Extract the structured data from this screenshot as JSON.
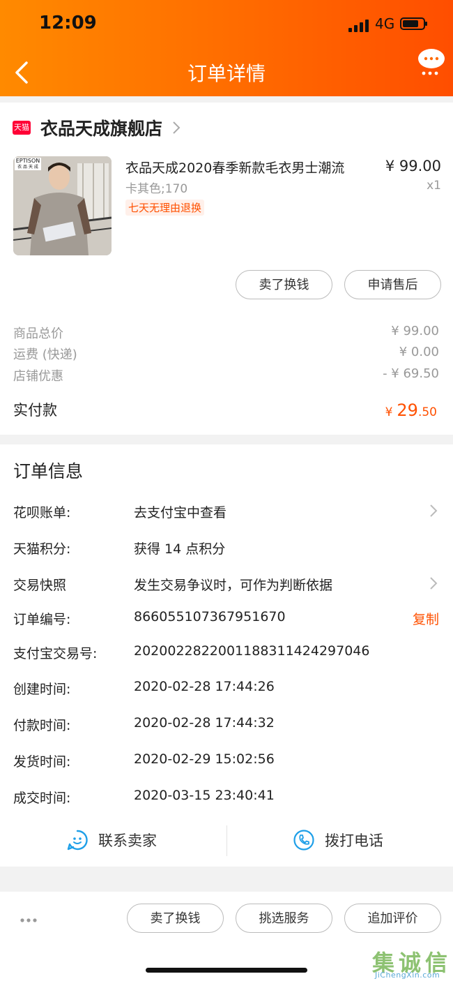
{
  "status_bar": {
    "time": "12:09",
    "network": "4G"
  },
  "header": {
    "title": "订单详情"
  },
  "store": {
    "logo_text": "天猫",
    "name": "衣品天成旗舰店"
  },
  "product": {
    "image_brand": "EPTISON",
    "image_brand_sub": "衣 品 天 成",
    "title": "衣品天成2020春季新款毛衣男士潮流",
    "price": "¥ 99.00",
    "sku": "卡其色;170",
    "qty": "x1",
    "tag": "七天无理由退换"
  },
  "item_actions": {
    "sell_label": "卖了换钱",
    "after_sale_label": "申请售后"
  },
  "fees": [
    {
      "label": "商品总价",
      "value": "¥ 99.00"
    },
    {
      "label": "运费 (快递)",
      "value": "¥ 0.00"
    },
    {
      "label": "店铺优惠",
      "value": "- ¥ 69.50"
    }
  ],
  "payment": {
    "label": "实付款",
    "currency": "¥",
    "int": "29",
    "dec": ".50"
  },
  "order_info": {
    "title": "订单信息",
    "rows": [
      {
        "label": "花呗账单:",
        "value": "去支付宝中查看"
      },
      {
        "label": "天猫积分:",
        "value": "获得 14 点积分"
      },
      {
        "label": "交易快照",
        "value": "发生交易争议时，可作为判断依据"
      },
      {
        "label": "订单编号:",
        "value": "866055107367951670"
      },
      {
        "label": "支付宝交易号:",
        "value": "2020022822001188311424297046"
      },
      {
        "label": "创建时间:",
        "value": "2020-02-28 17:44:26"
      },
      {
        "label": "付款时间:",
        "value": "2020-02-28 17:44:32"
      },
      {
        "label": "发货时间:",
        "value": "2020-02-29 15:02:56"
      },
      {
        "label": "成交时间:",
        "value": "2020-03-15 23:40:41"
      }
    ],
    "copy_label": "复制"
  },
  "contact": {
    "seller_label": "联系卖家",
    "phone_label": "拨打电话"
  },
  "bottom_actions": {
    "sell_label": "卖了换钱",
    "select_service_label": "挑选服务",
    "add_review_label": "追加评价"
  },
  "watermark": {
    "chars": [
      "集",
      "诚",
      "信"
    ],
    "url": "JiChengXin.com"
  },
  "colors": {
    "accent": "#ff5000",
    "header_start": "#ff8a00",
    "header_end": "#ff4e00",
    "tmall_red": "#ff0036"
  }
}
